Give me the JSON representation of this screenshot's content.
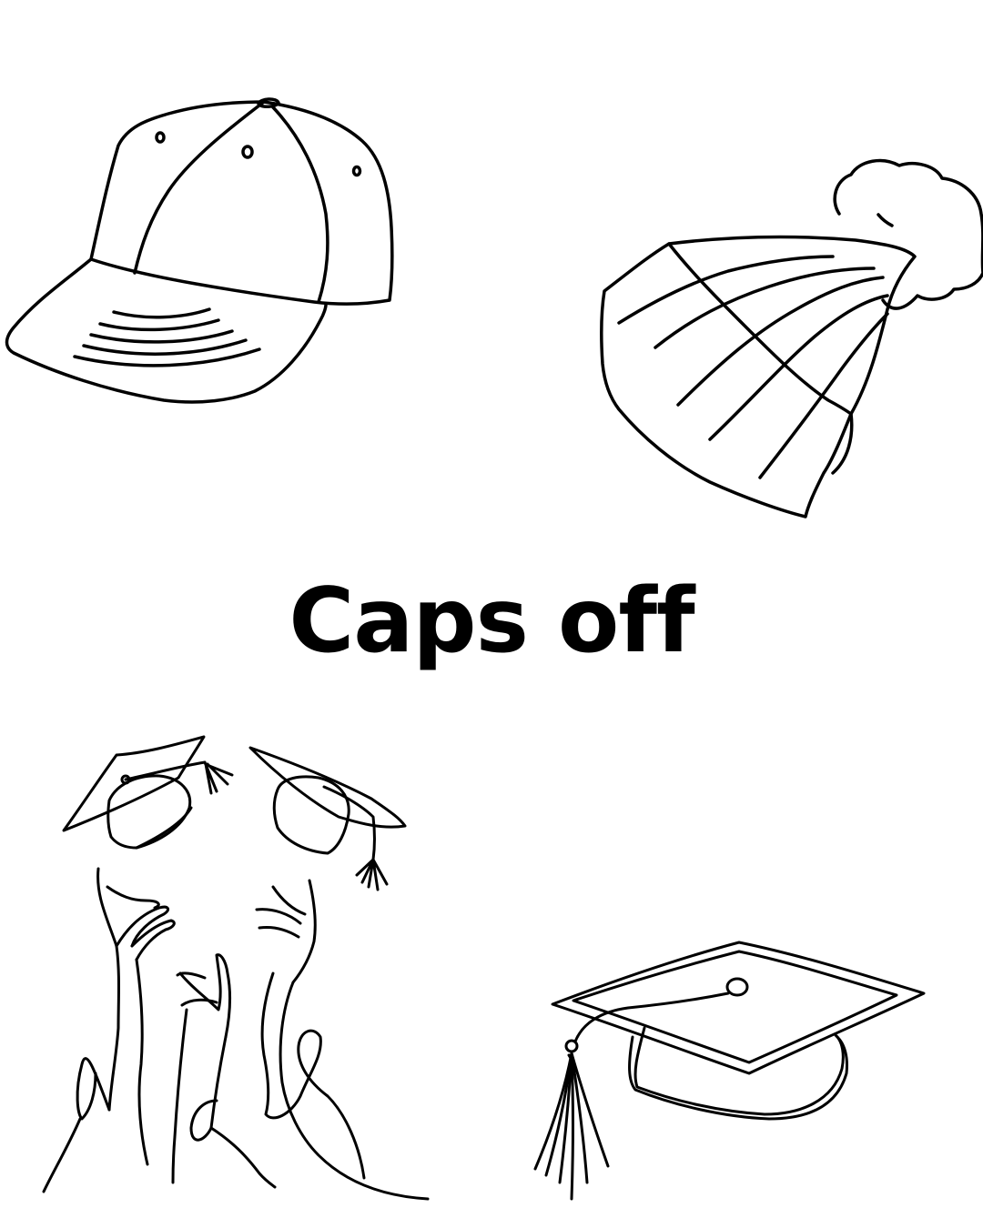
{
  "title": "Caps off",
  "colors": {
    "background": "#ffffff",
    "ink": "#000000"
  },
  "illustrations": [
    "baseball-cap-icon",
    "beanie-icon",
    "graduation-toss-illustration",
    "graduation-cap-icon"
  ]
}
